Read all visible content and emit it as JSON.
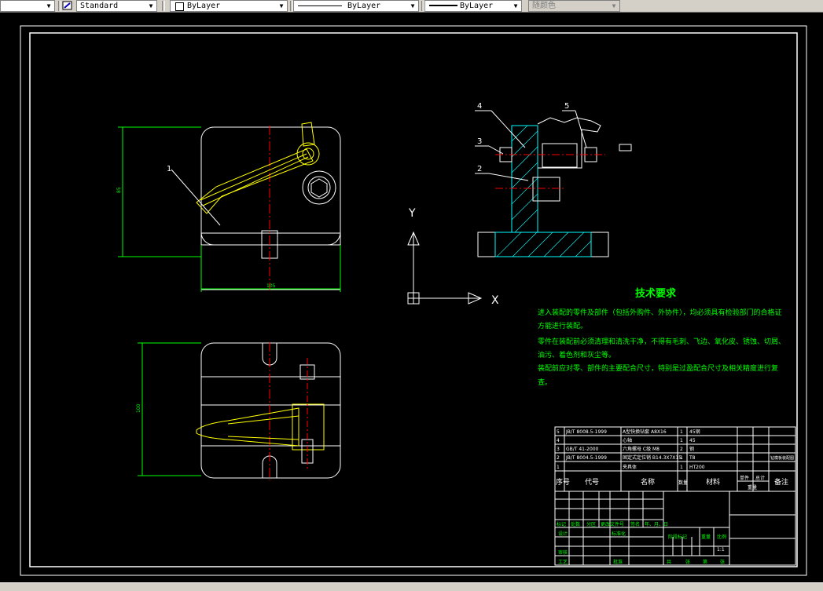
{
  "toolbar": {
    "text_style": "Standard",
    "layer": "ByLayer",
    "linetype": "ByLayer",
    "lineweight": "ByLayer",
    "plot_style": "随颜色"
  },
  "drawing": {
    "part_labels": [
      "1",
      "2",
      "3",
      "4",
      "5"
    ],
    "dim_height_front": "85",
    "dim_width_front": "105",
    "dim_height_top": "100",
    "ucs": {
      "y": "Y",
      "x": "X"
    }
  },
  "tech_req": {
    "title": "技术要求",
    "lines": [
      "进入装配的零件及部件（包括外购件、外协件），均必须具有检验部门的合格证",
      "方能进行装配。",
      "零件在装配前必须清理和清洗干净，不得有毛刺、飞边、氧化皮、锈蚀、切屑、",
      "油污、着色剂和灰尘等。",
      "装配前应对零、部件的主要配合尺寸，特别是过盈配合尺寸及相关精度进行复",
      "查。"
    ]
  },
  "bom": {
    "rows": [
      [
        "5",
        "JB/T 8008.5-1999",
        "A型快换钻套 A8X16",
        "1",
        "45钢"
      ],
      [
        "4",
        "",
        "心轴",
        "1",
        "45"
      ],
      [
        "3",
        "GB/T 41-2000",
        "六角螺母 C级 M8",
        "2",
        "钢"
      ],
      [
        "2",
        "JB/T 8004.5-1999",
        "固定式定位销 B14.3X7X15",
        "1",
        "T8"
      ],
      [
        "1",
        "",
        "夹具体",
        "1",
        "HT200"
      ]
    ],
    "header": [
      "序号",
      "代号",
      "名称",
      "数量",
      "材料",
      "单件",
      "总计",
      "备注"
    ],
    "weight_label": "重量",
    "right_label": "钻模板装配图"
  },
  "title_block": {
    "row1": [
      "标记",
      "处数",
      "分区",
      "更改文件号",
      "签名",
      "年、月、日"
    ],
    "design": "设计",
    "standard": "标准化",
    "stage_mark": "阶段标记",
    "weight": "重量",
    "scale": "比例",
    "scale_value": "1:1",
    "check": "审核",
    "process": "工艺",
    "approve": "批准",
    "sheets": [
      "共",
      "张",
      "第",
      "张"
    ]
  }
}
